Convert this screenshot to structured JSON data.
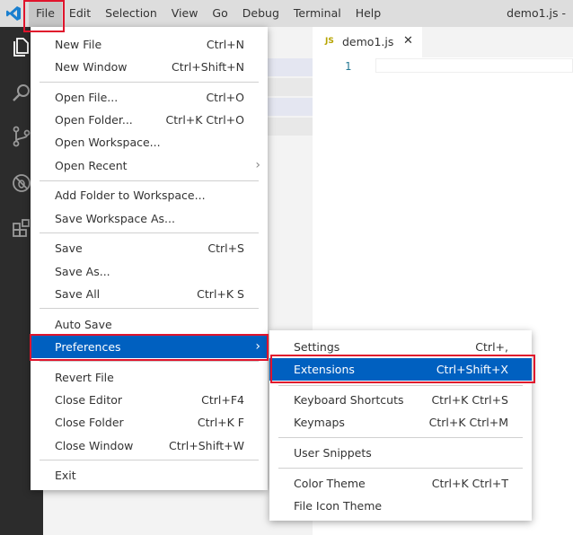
{
  "menubar": {
    "items": [
      "File",
      "Edit",
      "Selection",
      "View",
      "Go",
      "Debug",
      "Terminal",
      "Help"
    ]
  },
  "window_title": "demo1.js -",
  "editor": {
    "tab_label": "demo1.js",
    "tab_lang_badge": "JS",
    "close_glyph": "✕",
    "line_number": "1"
  },
  "file_menu": {
    "new_file": {
      "label": "New File",
      "key": "Ctrl+N"
    },
    "new_window": {
      "label": "New Window",
      "key": "Ctrl+Shift+N"
    },
    "open_file": {
      "label": "Open File...",
      "key": "Ctrl+O"
    },
    "open_folder": {
      "label": "Open Folder...",
      "key": "Ctrl+K Ctrl+O"
    },
    "open_workspace": {
      "label": "Open Workspace..."
    },
    "open_recent": {
      "label": "Open Recent"
    },
    "add_folder": {
      "label": "Add Folder to Workspace..."
    },
    "save_workspace_as": {
      "label": "Save Workspace As..."
    },
    "save": {
      "label": "Save",
      "key": "Ctrl+S"
    },
    "save_as": {
      "label": "Save As..."
    },
    "save_all": {
      "label": "Save All",
      "key": "Ctrl+K S"
    },
    "auto_save": {
      "label": "Auto Save"
    },
    "preferences": {
      "label": "Preferences"
    },
    "revert_file": {
      "label": "Revert File"
    },
    "close_editor": {
      "label": "Close Editor",
      "key": "Ctrl+F4"
    },
    "close_folder": {
      "label": "Close Folder",
      "key": "Ctrl+K F"
    },
    "close_window": {
      "label": "Close Window",
      "key": "Ctrl+Shift+W"
    },
    "exit": {
      "label": "Exit"
    }
  },
  "preferences_menu": {
    "settings": {
      "label": "Settings",
      "key": "Ctrl+,"
    },
    "extensions": {
      "label": "Extensions",
      "key": "Ctrl+Shift+X"
    },
    "keyboard_shortcuts": {
      "label": "Keyboard Shortcuts",
      "key": "Ctrl+K Ctrl+S"
    },
    "keymaps": {
      "label": "Keymaps",
      "key": "Ctrl+K Ctrl+M"
    },
    "user_snippets": {
      "label": "User Snippets"
    },
    "color_theme": {
      "label": "Color Theme",
      "key": "Ctrl+K Ctrl+T"
    },
    "file_icon_theme": {
      "label": "File Icon Theme"
    }
  },
  "icons": {
    "submenu_arrow": "›",
    "activity": [
      "explorer-icon",
      "search-icon",
      "source-control-icon",
      "debug-icon",
      "extensions-icon"
    ]
  },
  "colors": {
    "selection": "#0060c0",
    "highlight_box": "#e0142c",
    "activity_bar": "#2c2c2c",
    "title_bar": "#dddddd"
  }
}
